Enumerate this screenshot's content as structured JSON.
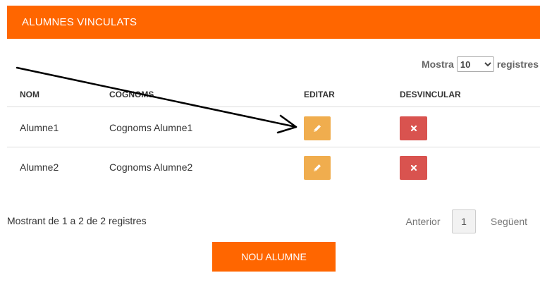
{
  "panel": {
    "title": "ALUMNES VINCULATS"
  },
  "length": {
    "prefix": "Mostra",
    "value": "10",
    "suffix": "registres",
    "options": [
      "10"
    ]
  },
  "table": {
    "headers": {
      "name": "NOM",
      "surnames": "COGNOMS",
      "edit": "EDITAR",
      "unlink": "DESVINCULAR"
    },
    "rows": [
      {
        "name": "Alumne1",
        "surnames": "Cognoms Alumne1"
      },
      {
        "name": "Alumne2",
        "surnames": "Cognoms Alumne2"
      }
    ]
  },
  "footer": {
    "info": "Mostrant de 1 a 2 de 2 registres",
    "previous": "Anterior",
    "page": "1",
    "next": "Següent"
  },
  "new_button": "NOU ALUMNE",
  "colors": {
    "accent": "#ff6600",
    "edit": "#f0ad4e",
    "delete": "#d9534f"
  },
  "icons": {
    "edit": "pencil-icon",
    "delete": "close-icon",
    "annotation": "arrow-annotation"
  }
}
